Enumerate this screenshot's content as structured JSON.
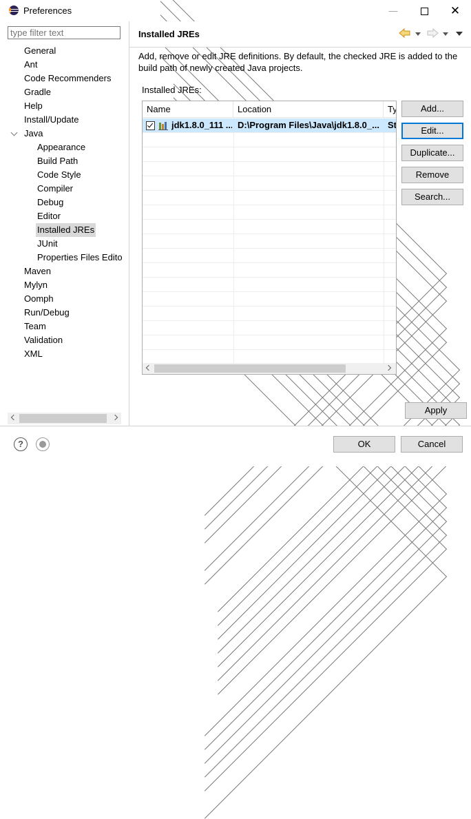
{
  "window": {
    "title": "Preferences",
    "minimize_glyph": "—"
  },
  "sidebar": {
    "filter_placeholder": "type filter text",
    "items": [
      {
        "label": "General",
        "expander": "collapsed",
        "level": 0
      },
      {
        "label": "Ant",
        "expander": "collapsed",
        "level": 0
      },
      {
        "label": "Code Recommenders",
        "expander": "collapsed",
        "level": 0
      },
      {
        "label": "Gradle",
        "expander": "none",
        "level": 0
      },
      {
        "label": "Help",
        "expander": "collapsed",
        "level": 0
      },
      {
        "label": "Install/Update",
        "expander": "collapsed",
        "level": 0
      },
      {
        "label": "Java",
        "expander": "expanded",
        "level": 0
      },
      {
        "label": "Appearance",
        "expander": "collapsed",
        "level": 1
      },
      {
        "label": "Build Path",
        "expander": "collapsed",
        "level": 1
      },
      {
        "label": "Code Style",
        "expander": "collapsed",
        "level": 1
      },
      {
        "label": "Compiler",
        "expander": "collapsed",
        "level": 1
      },
      {
        "label": "Debug",
        "expander": "collapsed",
        "level": 1
      },
      {
        "label": "Editor",
        "expander": "collapsed",
        "level": 1
      },
      {
        "label": "Installed JREs",
        "expander": "collapsed",
        "level": 1,
        "selected": true
      },
      {
        "label": "JUnit",
        "expander": "none",
        "level": 1
      },
      {
        "label": "Properties Files Edito",
        "expander": "none",
        "level": 1
      },
      {
        "label": "Maven",
        "expander": "collapsed",
        "level": 0
      },
      {
        "label": "Mylyn",
        "expander": "collapsed",
        "level": 0
      },
      {
        "label": "Oomph",
        "expander": "collapsed",
        "level": 0
      },
      {
        "label": "Run/Debug",
        "expander": "collapsed",
        "level": 0
      },
      {
        "label": "Team",
        "expander": "collapsed",
        "level": 0
      },
      {
        "label": "Validation",
        "expander": "none",
        "level": 0
      },
      {
        "label": "XML",
        "expander": "collapsed",
        "level": 0
      }
    ]
  },
  "page": {
    "title": "Installed JREs",
    "description": "Add, remove or edit JRE definitions. By default, the checked JRE is added to the build path of newly created Java projects.",
    "list_label": "Installed JREs:"
  },
  "table": {
    "columns": [
      "Name",
      "Location",
      "Ty"
    ],
    "rows": [
      {
        "checked": true,
        "name": "jdk1.8.0_111 ...",
        "location": "D:\\Program Files\\Java\\jdk1.8.0_...",
        "type": "St"
      }
    ]
  },
  "side_buttons": {
    "add": "Add...",
    "edit": "Edit...",
    "duplicate": "Duplicate...",
    "remove": "Remove",
    "search": "Search..."
  },
  "apply_label": "Apply",
  "footer": {
    "help_glyph": "?",
    "ok_label": "OK",
    "cancel_label": "Cancel"
  },
  "colors": {
    "accent": "#0078d7",
    "selection": "#cce8ff",
    "nav_arrow": "#e8a21a"
  }
}
